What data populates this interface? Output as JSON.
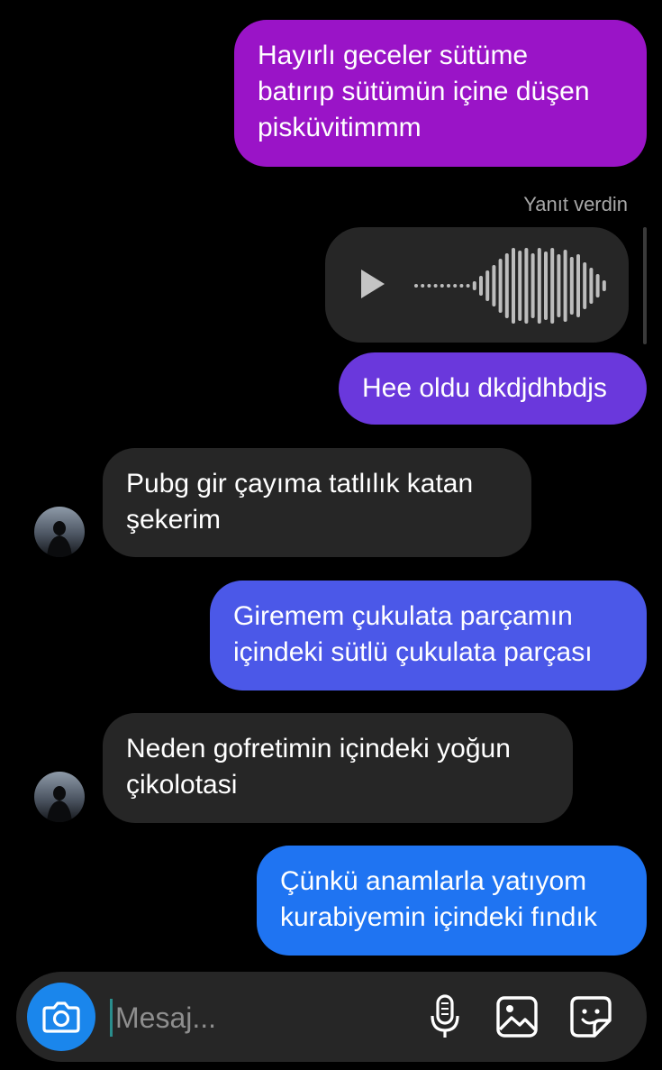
{
  "messages": [
    {
      "text": "Hayırlı geceler sütüme\nbatırıp sütümün içine düşen\npisküvitimmm"
    },
    {
      "text": "Hee oldu dkdjdhbdjs"
    },
    {
      "text": "Pubg gir çayıma tatlılık katan\nşekerim"
    },
    {
      "text": "Giremem çukulata parçamın\niçindeki sütlü çukulata parçası"
    },
    {
      "text": "Neden gofretimin içindeki yoğun\nçikolotasi"
    },
    {
      "text": "Çünkü anamlarla yatıyom\nkurabiyemin içindeki fındık"
    }
  ],
  "reply_meta": "Yanıt verdin",
  "composer": {
    "placeholder": "Mesaj..."
  },
  "colors": {
    "gradient_top": "#9a14c7",
    "gradient_mid": "#6a38dc",
    "gradient_low": "#4b58e8",
    "gradient_bottom": "#1f74f2",
    "received": "#262626",
    "camera": "#1a86ec"
  },
  "icons": [
    "play-icon",
    "waveform-icon",
    "camera-icon",
    "microphone-icon",
    "gallery-icon",
    "sticker-icon"
  ]
}
